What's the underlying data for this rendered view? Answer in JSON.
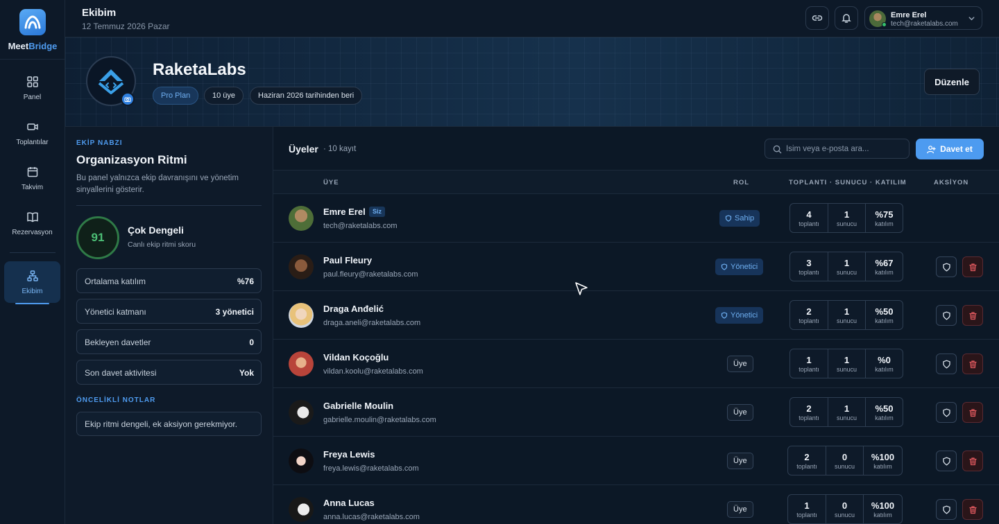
{
  "app": {
    "name_prefix": "Meet",
    "name_suffix": "Bridge"
  },
  "colors": {
    "accent": "#4f9cf0",
    "background": "#0b1624",
    "danger": "#e35a5f",
    "success": "#4cbf76"
  },
  "sidebar": {
    "items": [
      {
        "label": "Panel",
        "icon": "grid-icon"
      },
      {
        "label": "Toplantılar",
        "icon": "video-icon"
      },
      {
        "label": "Takvim",
        "icon": "calendar-icon"
      },
      {
        "label": "Rezervasyon",
        "icon": "book-icon"
      },
      {
        "label": "Ekibim",
        "icon": "team-icon",
        "active": true
      }
    ]
  },
  "header": {
    "title": "Ekibim",
    "date": "12 Temmuz 2026 Pazar",
    "user": {
      "name": "Emre Erel",
      "email": "tech@raketalabs.com"
    }
  },
  "org": {
    "name": "RaketaLabs",
    "plan": "Pro Plan",
    "members": "10 üye",
    "since": "Haziran 2026 tarihinden beri",
    "edit_label": "Düzenle"
  },
  "pulse": {
    "eyebrow": "EKİP NABZI",
    "title": "Organizasyon Ritmi",
    "description": "Bu panel yalnızca ekip davranışını ve yönetim sinyallerini gösterir.",
    "score": "91",
    "score_label": "Çok Dengeli",
    "score_sub": "Canlı ekip ritmi skoru",
    "stats": [
      {
        "label": "Ortalama katılım",
        "value": "%76"
      },
      {
        "label": "Yönetici katmanı",
        "value": "3 yönetici"
      },
      {
        "label": "Bekleyen davetler",
        "value": "0"
      },
      {
        "label": "Son davet aktivitesi",
        "value": "Yok"
      }
    ],
    "notes_title": "ÖNCELİKLİ NOTLAR",
    "note": "Ekip ritmi dengeli, ek aksiyon gerekmiyor."
  },
  "members": {
    "title": "Üyeler",
    "count": "· 10 kayıt",
    "search_placeholder": "İsim veya e-posta ara...",
    "invite_label": "Davet et",
    "headers": {
      "member": "ÜYE",
      "role": "ROL",
      "stats": "TOPLANTI · SUNUCU · KATILIM",
      "actions": "AKSİYON"
    },
    "stat_labels": {
      "meetings": "toplantı",
      "host": "sunucu",
      "attendance": "katılım"
    },
    "rows": [
      {
        "name": "Emre Erel",
        "you": "Siz",
        "email": "tech@raketalabs.com",
        "role": "Sahip",
        "role_type": "badge",
        "meetings": "4",
        "host": "1",
        "attendance": "%75",
        "actions": false
      },
      {
        "name": "Paul Fleury",
        "you": "",
        "email": "paul.fleury@raketalabs.com",
        "role": "Yönetici",
        "role_type": "badge",
        "meetings": "3",
        "host": "1",
        "attendance": "%67",
        "actions": true
      },
      {
        "name": "Draga Anđelić",
        "you": "",
        "email": "draga.aneli@raketalabs.com",
        "role": "Yönetici",
        "role_type": "badge",
        "meetings": "2",
        "host": "1",
        "attendance": "%50",
        "actions": true
      },
      {
        "name": "Vildan Koçoğlu",
        "you": "",
        "email": "vildan.koolu@raketalabs.com",
        "role": "Üye",
        "role_type": "plain",
        "meetings": "1",
        "host": "1",
        "attendance": "%0",
        "actions": true
      },
      {
        "name": "Gabrielle Moulin",
        "you": "",
        "email": "gabrielle.moulin@raketalabs.com",
        "role": "Üye",
        "role_type": "plain",
        "meetings": "2",
        "host": "1",
        "attendance": "%50",
        "actions": true
      },
      {
        "name": "Freya Lewis",
        "you": "",
        "email": "freya.lewis@raketalabs.com",
        "role": "Üye",
        "role_type": "plain",
        "meetings": "2",
        "host": "0",
        "attendance": "%100",
        "actions": true
      },
      {
        "name": "Anna Lucas",
        "you": "",
        "email": "anna.lucas@raketalabs.com",
        "role": "Üye",
        "role_type": "plain",
        "meetings": "1",
        "host": "0",
        "attendance": "%100",
        "actions": true
      }
    ]
  }
}
